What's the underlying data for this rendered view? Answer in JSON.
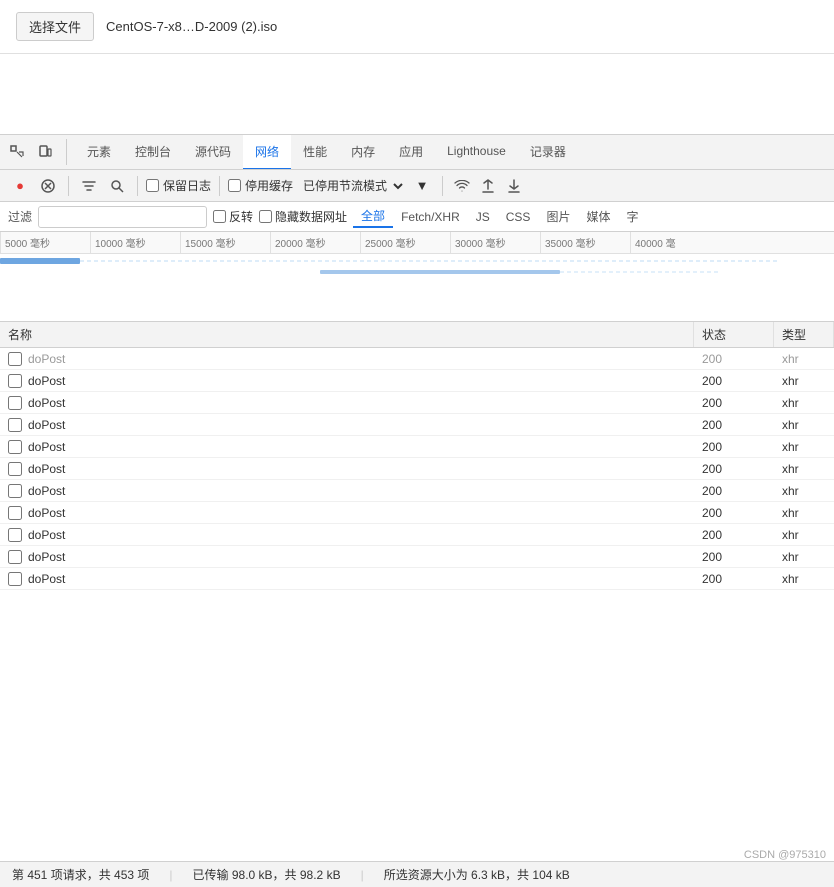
{
  "topSection": {
    "chooseFileLabel": "选择文件",
    "fileName": "CentOS-7-x8…D-2009 (2).iso"
  },
  "devtools": {
    "tabs": [
      {
        "id": "elements",
        "label": "元素",
        "active": false
      },
      {
        "id": "console",
        "label": "控制台",
        "active": false
      },
      {
        "id": "sources",
        "label": "源代码",
        "active": false
      },
      {
        "id": "network",
        "label": "网络",
        "active": true
      },
      {
        "id": "performance",
        "label": "性能",
        "active": false
      },
      {
        "id": "memory",
        "label": "内存",
        "active": false
      },
      {
        "id": "application",
        "label": "应用",
        "active": false
      },
      {
        "id": "lighthouse",
        "label": "Lighthouse",
        "active": false
      },
      {
        "id": "recorder",
        "label": "记录器",
        "active": false
      }
    ],
    "toolbar": {
      "recordLabel": "●",
      "stopLabel": "🚫",
      "filterLabel": "▼",
      "searchLabel": "🔍",
      "preserveLog": "保留日志",
      "disableCache": "停用缓存",
      "throttle": "已停用节流模式",
      "wifiLabel": "📶",
      "uploadLabel": "⬆",
      "downloadLabel": "⬇"
    },
    "filterBar": {
      "filterLabel": "过滤",
      "reverseLabel": "反转",
      "hideDataUrls": "隐藏数据网址",
      "typeTabs": [
        {
          "id": "all",
          "label": "全部",
          "active": true
        },
        {
          "id": "fetchxhr",
          "label": "Fetch/XHR",
          "active": false
        },
        {
          "id": "js",
          "label": "JS",
          "active": false
        },
        {
          "id": "css",
          "label": "CSS",
          "active": false
        },
        {
          "id": "img",
          "label": "图片",
          "active": false
        },
        {
          "id": "media",
          "label": "媒体",
          "active": false
        },
        {
          "id": "more",
          "label": "字",
          "active": false
        }
      ]
    },
    "timeline": {
      "ticks": [
        "5000 毫秒",
        "10000 毫秒",
        "15000 毫秒",
        "20000 毫秒",
        "25000 毫秒",
        "30000 毫秒",
        "35000 毫秒",
        "40000 毫"
      ]
    },
    "table": {
      "headers": [
        {
          "id": "name",
          "label": "名称"
        },
        {
          "id": "status",
          "label": "状态"
        },
        {
          "id": "type",
          "label": "类型"
        }
      ],
      "rows": [
        {
          "name": "doPost",
          "status": "200",
          "type": "xhr",
          "partial": true
        },
        {
          "name": "doPost",
          "status": "200",
          "type": "xhr",
          "partial": false
        },
        {
          "name": "doPost",
          "status": "200",
          "type": "xhr",
          "partial": false
        },
        {
          "name": "doPost",
          "status": "200",
          "type": "xhr",
          "partial": false
        },
        {
          "name": "doPost",
          "status": "200",
          "type": "xhr",
          "partial": false
        },
        {
          "name": "doPost",
          "status": "200",
          "type": "xhr",
          "partial": false
        },
        {
          "name": "doPost",
          "status": "200",
          "type": "xhr",
          "partial": false
        },
        {
          "name": "doPost",
          "status": "200",
          "type": "xhr",
          "partial": false
        },
        {
          "name": "doPost",
          "status": "200",
          "type": "xhr",
          "partial": false
        },
        {
          "name": "doPost",
          "status": "200",
          "type": "xhr",
          "partial": false
        },
        {
          "name": "doPost",
          "status": "200",
          "type": "xhr",
          "partial": false
        }
      ]
    },
    "statusBar": {
      "requests": "第 451 项请求，共 453 项",
      "transferred": "已传输 98.0 kB，共 98.2 kB",
      "resources": "所选资源大小为 6.3 kB，共 104 kB"
    }
  },
  "watermark": "CSDN @975310"
}
